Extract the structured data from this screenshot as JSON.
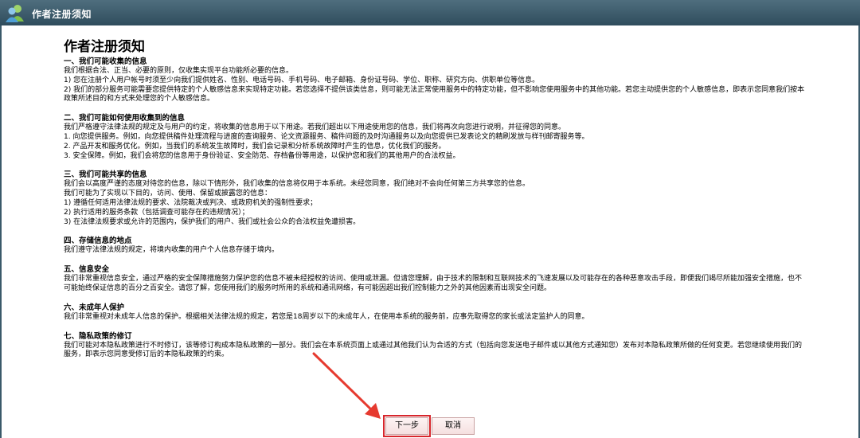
{
  "window": {
    "title": "作者注册须知"
  },
  "doc": {
    "heading": "作者注册须知",
    "sections": [
      {
        "title": "一、我们可能收集的信息",
        "lines": [
          "我们根据合法、正当、必要的原则，仅收集实现平台功能所必要的信息。",
          "1) 您在注册个人用户帐号时须至少向我们提供姓名、性别、电话号码、手机号码、电子邮箱、身份证号码、学位、职称、研究方向、供职单位等信息。",
          "2) 我们的部分服务可能需要您提供特定的个人敏感信息来实现特定功能。若您选择不提供该类信息，则可能无法正常使用服务中的特定功能，但不影响您使用服务中的其他功能。若您主动提供您的个人敏感信息，即表示您同意我们按本政策所述目的和方式来处理您的个人敏感信息。"
        ]
      },
      {
        "title": "二、我们可能如何使用收集到的信息",
        "lines": [
          "我们严格遵守法律法规的规定及与用户的约定，将收集的信息用于以下用途。若我们超出以下用途使用您的信息，我们将再次向您进行说明，并征得您的同意。",
          "1. 向您提供服务。例如，向您提供稿件处理流程与进度的查询服务、论文资源服务、稿件问题的及时沟通服务以及向您提供已发表论文的精刷发放与样刊邮寄服务等。",
          "2. 产品开发和服务优化。例如，当我们的系统发生故障时，我们会记录和分析系统故障时产生的信息，优化我们的服务。",
          "3. 安全保障。例如，我们会将您的信息用于身份验证、安全防范、存档备份等用途，以保护您和我们的其他用户的合法权益。"
        ]
      },
      {
        "title": "三、我们可能共享的信息",
        "lines": [
          "我们会以高度严谨的态度对待您的信息，除以下情形外，我们收集的信息将仅用于本系统。未经您同意，我们绝对不会向任何第三方共享您的信息。",
          "我们可能为了实现以下目的，访问、使用、保留或披露您的信息：",
          "1) 遵循任何适用法律法规的要求、法院裁决或判决、或政府机关的强制性要求；",
          "2) 执行适用的服务条款（包括调查可能存在的违规情况）；",
          "3) 在法律法规要求或允许的范围内，保护我们的用户、我们或社会公众的合法权益免遭损害。"
        ]
      },
      {
        "title": "四、存储信息的地点",
        "lines": [
          "我们遵守法律法规的规定，将境内收集的用户个人信息存储于境内。"
        ]
      },
      {
        "title": "五、信息安全",
        "lines": [
          "我们非常重视信息安全，通过严格的安全保障措施努力保护您的信息不被未经授权的访问、使用或泄漏。但请您理解，由于技术的限制和互联网技术的飞速发展以及可能存在的各种恶意攻击手段，即便我们竭尽所能加强安全措施，也不可能始终保证信息的百分之百安全。请您了解，您使用我们的服务时所用的系统和通讯网络，有可能因超出我们控制能力之外的其他因素而出现安全问题。"
        ]
      },
      {
        "title": "六、未成年人保护",
        "lines": [
          "我们非常重视对未成年人信息的保护。根据相关法律法规的规定，若您是18周岁以下的未成年人，在使用本系统的服务前，应事先取得您的家长或法定监护人的同意。"
        ]
      },
      {
        "title": "七、隐私政策的修订",
        "lines": [
          "我们可能对本隐私政策进行不时修订，该等修订构成本隐私政策的一部分。我们会在本系统页面上或通过其他我们认为合适的方式（包括向您发送电子邮件或以其他方式通知您）发布对本隐私政策所做的任何变更。若您继续使用我们的服务，即表示您同意受修订后的本隐私政策的约束。"
        ]
      }
    ]
  },
  "buttons": {
    "next": "下一步",
    "cancel": "取消"
  },
  "colors": {
    "titlebar": "#3a5a6a",
    "highlight": "#d7262c"
  },
  "icons": {
    "logo": "users-icon",
    "annotation": "arrow-icon"
  }
}
